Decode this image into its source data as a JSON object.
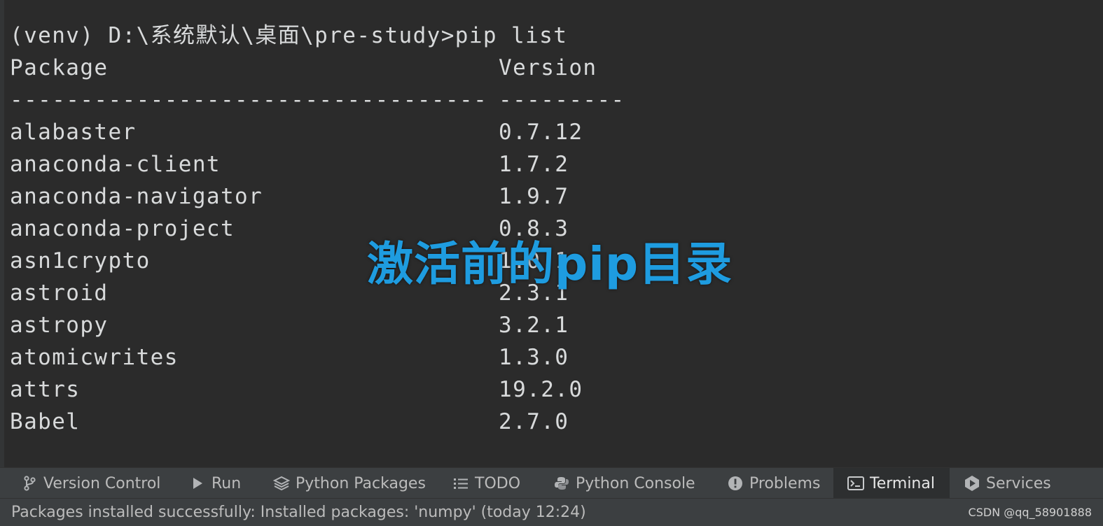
{
  "terminal": {
    "command_line": "(venv) D:\\系统默认\\桌面\\pre-study>pip list",
    "header": {
      "package": "Package",
      "version": "Version"
    },
    "separator": {
      "package": "----------------------------------",
      "version": "---------"
    },
    "packages": [
      {
        "name": "alabaster",
        "version": "0.7.12"
      },
      {
        "name": "anaconda-client",
        "version": "1.7.2"
      },
      {
        "name": "anaconda-navigator",
        "version": "1.9.7"
      },
      {
        "name": "anaconda-project",
        "version": "0.8.3"
      },
      {
        "name": "asn1crypto",
        "version": "1.0.1"
      },
      {
        "name": "astroid",
        "version": "2.3.1"
      },
      {
        "name": "astropy",
        "version": "3.2.1"
      },
      {
        "name": "atomicwrites",
        "version": "1.3.0"
      },
      {
        "name": "attrs",
        "version": "19.2.0"
      },
      {
        "name": "Babel",
        "version": "2.7.0"
      }
    ]
  },
  "overlay": {
    "caption": "激活前的pip目录"
  },
  "tool_window_tabs": [
    {
      "label": "Version Control",
      "icon": "branch-icon"
    },
    {
      "label": "Run",
      "icon": "play-icon"
    },
    {
      "label": "Python Packages",
      "icon": "layers-icon"
    },
    {
      "label": "TODO",
      "icon": "list-icon"
    },
    {
      "label": "Python Console",
      "icon": "python-icon"
    },
    {
      "label": "Problems",
      "icon": "warning-icon"
    },
    {
      "label": "Terminal",
      "icon": "terminal-icon",
      "active": true
    },
    {
      "label": "Services",
      "icon": "services-icon"
    }
  ],
  "status_bar": {
    "message": "Packages installed successfully: Installed packages: 'numpy' (today 12:24)",
    "watermark": "CSDN @qq_58901888"
  },
  "colors": {
    "background": "#2b2b2b",
    "text": "#d8dadb",
    "caption": "#1e9ce0",
    "toolbar": "#3c3f41"
  }
}
